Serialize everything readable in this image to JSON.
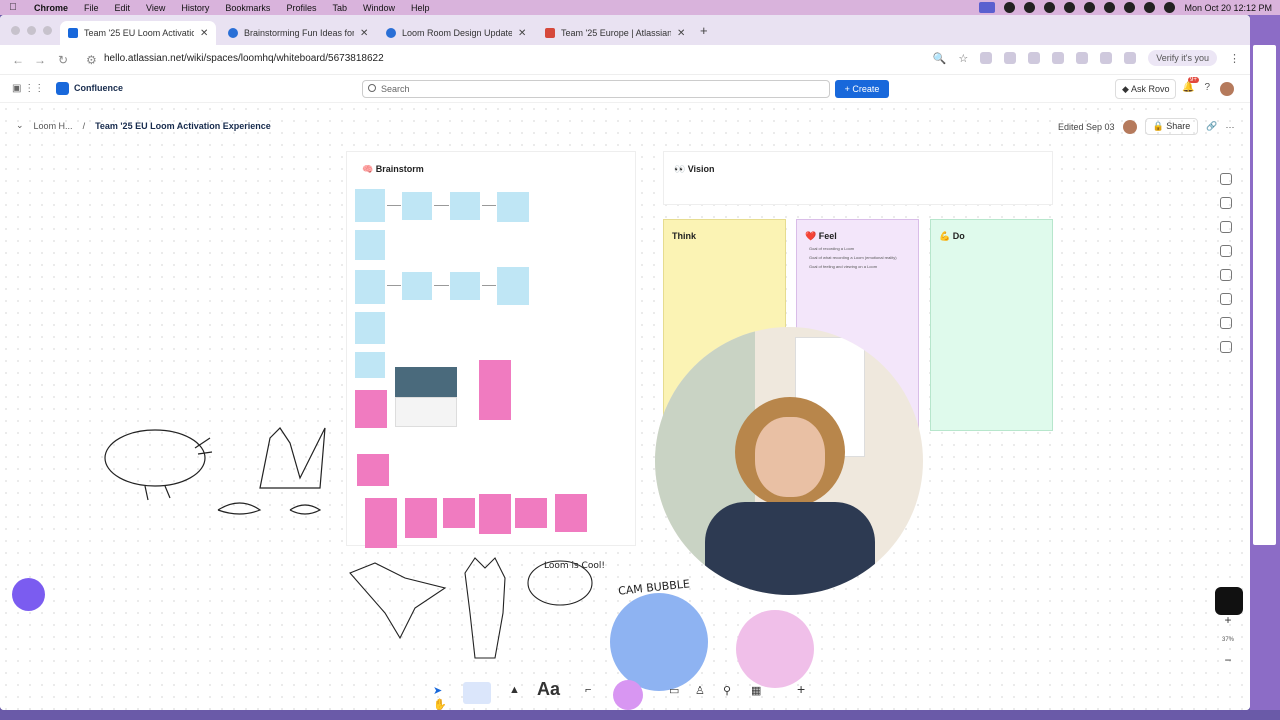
{
  "menubar": {
    "app": "Chrome",
    "items": [
      "File",
      "Edit",
      "View",
      "History",
      "Bookmarks",
      "Profiles",
      "Tab",
      "Window",
      "Help"
    ],
    "clock": "Mon Oct 20  12:12 PM"
  },
  "tabs": [
    {
      "label": "Team '25 EU Loom Activatio",
      "favicon": "confluence-icon",
      "active": true
    },
    {
      "label": "Brainstorming Fun Ideas for T",
      "favicon": "confluence-icon",
      "active": false
    },
    {
      "label": "Loom Room Design Update a",
      "favicon": "confluence-icon",
      "active": false
    },
    {
      "label": "Team '25 Europe | Atlassian H",
      "favicon": "atlassian-icon",
      "active": false
    }
  ],
  "address": {
    "url": "hello.atlassian.net/wiki/spaces/loomhq/whiteboard/5673818622",
    "verify_label": "Verify it's you"
  },
  "confluence": {
    "product": "Confluence",
    "search_placeholder": "Search",
    "create_label": "Create",
    "ask_rovo_label": "Ask Rovo",
    "notification_count": "9+"
  },
  "page": {
    "breadcrumb_parent": "Loom H...",
    "title": "Team '25 EU Loom Activation Experience",
    "edited": "Edited Sep 03",
    "share_label": "Share"
  },
  "whiteboard": {
    "brainstorm_title": "🧠 Brainstorm",
    "vision_title": "👀 Vision",
    "columns": [
      {
        "label": "Think",
        "emoji": "",
        "color": "#fbf3b4",
        "notes": []
      },
      {
        "label": "Feel",
        "emoji": "❤️",
        "color": "#f3e6fa",
        "notes": [
          "Goal of recording a Loom",
          "Goal of what recording a Loom (emotional reality)",
          "Goal of feeling and viewing on a Loom"
        ]
      },
      {
        "label": "Do",
        "emoji": "💪",
        "color": "#dffaec",
        "notes": []
      }
    ],
    "drawing_text": [
      "Loom is Cool!",
      "CAM BUBBLE"
    ],
    "zoom": "37%"
  },
  "toolbar": {
    "text_tool_label": "Aa"
  },
  "colors": {
    "accent": "#1868db",
    "menubar": "#d9b3dc",
    "sticky_blue": "#bfe6f5",
    "sticky_pink": "#f07bc0"
  }
}
